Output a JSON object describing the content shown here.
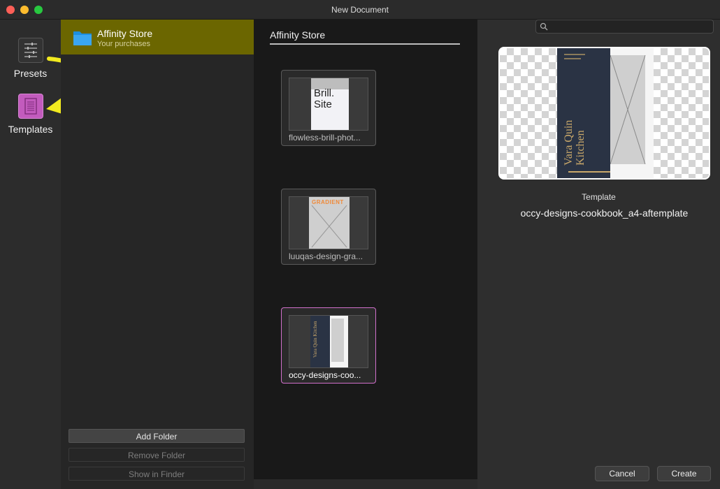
{
  "window": {
    "title": "New Document"
  },
  "categories": [
    {
      "label": "Presets",
      "icon": "sliders-icon"
    },
    {
      "label": "Templates",
      "icon": "template-icon"
    }
  ],
  "folders": {
    "selected": {
      "name": "Affinity Store",
      "subtitle": "Your purchases",
      "icon": "folder-icon"
    },
    "add_label": "Add Folder",
    "remove_label": "Remove Folder",
    "show_label": "Show in Finder"
  },
  "grid": {
    "title": "Affinity Store",
    "items": [
      {
        "label": "flowless-brill-phot...",
        "thumb_text_1": "Brill.",
        "thumb_text_2": "Site"
      },
      {
        "label": "luuqas-design-gra...",
        "thumb_text_1": "GRADIENT"
      },
      {
        "label": "occy-designs-coo...",
        "thumb_text_1": "Vara Quin Kitchen",
        "selected": true
      }
    ]
  },
  "preview": {
    "search_placeholder": "",
    "kind": "Template",
    "name": "occy-designs-cookbook_a4-aftemplate",
    "cover_title_1": "Vara Quin",
    "cover_title_2": "Kitchen"
  },
  "buttons": {
    "cancel": "Cancel",
    "create": "Create"
  },
  "colors": {
    "selection": "#6b6600",
    "accent_pink": "#d270cc",
    "annotation": "#f2ea1f"
  }
}
